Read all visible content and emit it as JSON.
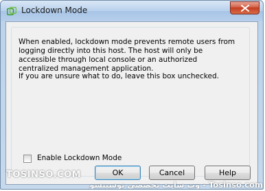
{
  "window": {
    "title": "Lockdown Mode",
    "icon": "vsphere-app-icon",
    "close_icon": "close-icon"
  },
  "content": {
    "description": "When enabled, lockdown mode prevents remote users from logging directly into this host. The host will only be accessible through local console or an authorized centralized management application.",
    "hint": "If you are unsure what to do, leave this box unchecked.",
    "checkbox_label": "Enable Lockdown Mode",
    "checkbox_checked": false
  },
  "buttons": {
    "ok": "OK",
    "cancel": "Cancel",
    "help": "Help"
  },
  "watermark": {
    "left": "TOSINSO.COM",
    "right": "وب سایت تخصصی توسینسو - Tosinso.com"
  },
  "colors": {
    "title_bar": "#b9d1ec",
    "close_button": "#c23d20",
    "client_background": "#f0f0f0",
    "default_button_border": "#3c7fb1"
  }
}
